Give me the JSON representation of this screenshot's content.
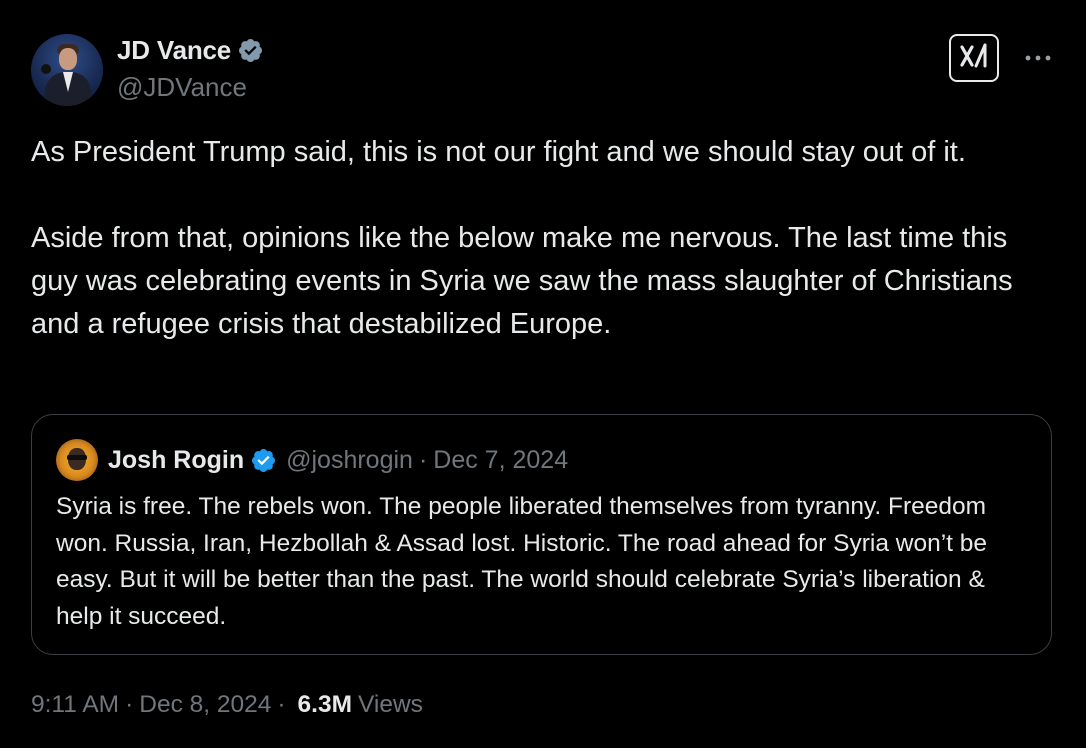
{
  "author": {
    "name": "JD Vance",
    "handle": "@JDVance",
    "verified": true
  },
  "tweet": {
    "paragraphs": [
      "As President Trump said, this is not our fight and we should stay out of it.",
      "Aside from that, opinions like the below make me nervous. The last time this guy was celebrating events in Syria we saw the mass slaughter of Christians and a refugee crisis that destabilized Europe."
    ]
  },
  "quoted": {
    "name": "Josh Rogin",
    "handle": "@joshrogin",
    "separator": "·",
    "date": "Dec 7, 2024",
    "verified": true,
    "text": "Syria is free. The rebels won. The people liberated themselves from tyranny. Freedom won. Russia, Iran, Hezbollah & Assad lost. Historic. The road ahead for Syria won’t be easy. But it will be better than the past. The world should celebrate Syria’s liberation & help it succeed."
  },
  "meta": {
    "time": "9:11 AM",
    "separator": "·",
    "date": "Dec 8, 2024",
    "views_count": "6.3M",
    "views_label": "Views"
  },
  "icons": {
    "verified": "verified-badge-icon",
    "grok": "grok-icon",
    "more": "more-icon"
  },
  "colors": {
    "background": "#000000",
    "text_primary": "#e7e9ea",
    "text_secondary": "#71767b",
    "verified_blue": "#1d9bf0",
    "verified_gray": "#829aab",
    "quote_border": "#3b3f43"
  }
}
